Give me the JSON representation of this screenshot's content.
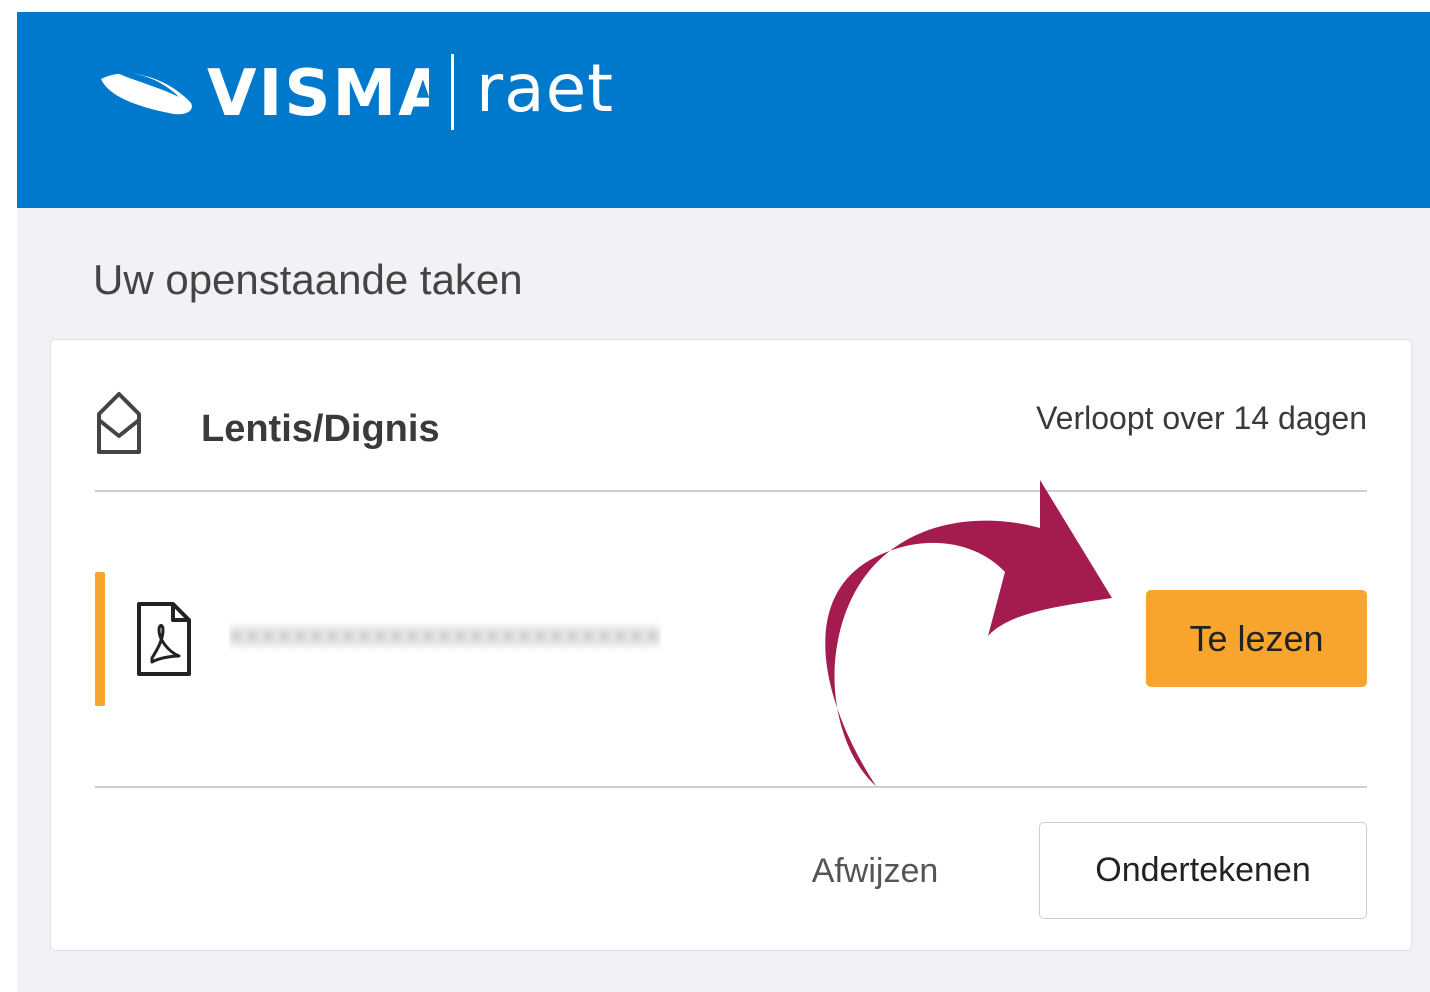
{
  "brand": {
    "name": "VISMA",
    "product": "raet"
  },
  "page": {
    "title": "Uw openstaande taken"
  },
  "task": {
    "sender": "Lentis/Dignis",
    "expires": "Verloopt over 14 dagen",
    "document": {
      "name_redacted": "xxxxxxxxxxxxxxxxxxxxxxxxxxx",
      "icon": "pdf-file-icon",
      "status_label": "Te lezen"
    },
    "actions": {
      "reject_label": "Afwijzen",
      "sign_label": "Ondertekenen"
    }
  },
  "colors": {
    "header": "#0079cc",
    "accent": "#f7a52d",
    "annotation_arrow": "#a31b4f"
  }
}
